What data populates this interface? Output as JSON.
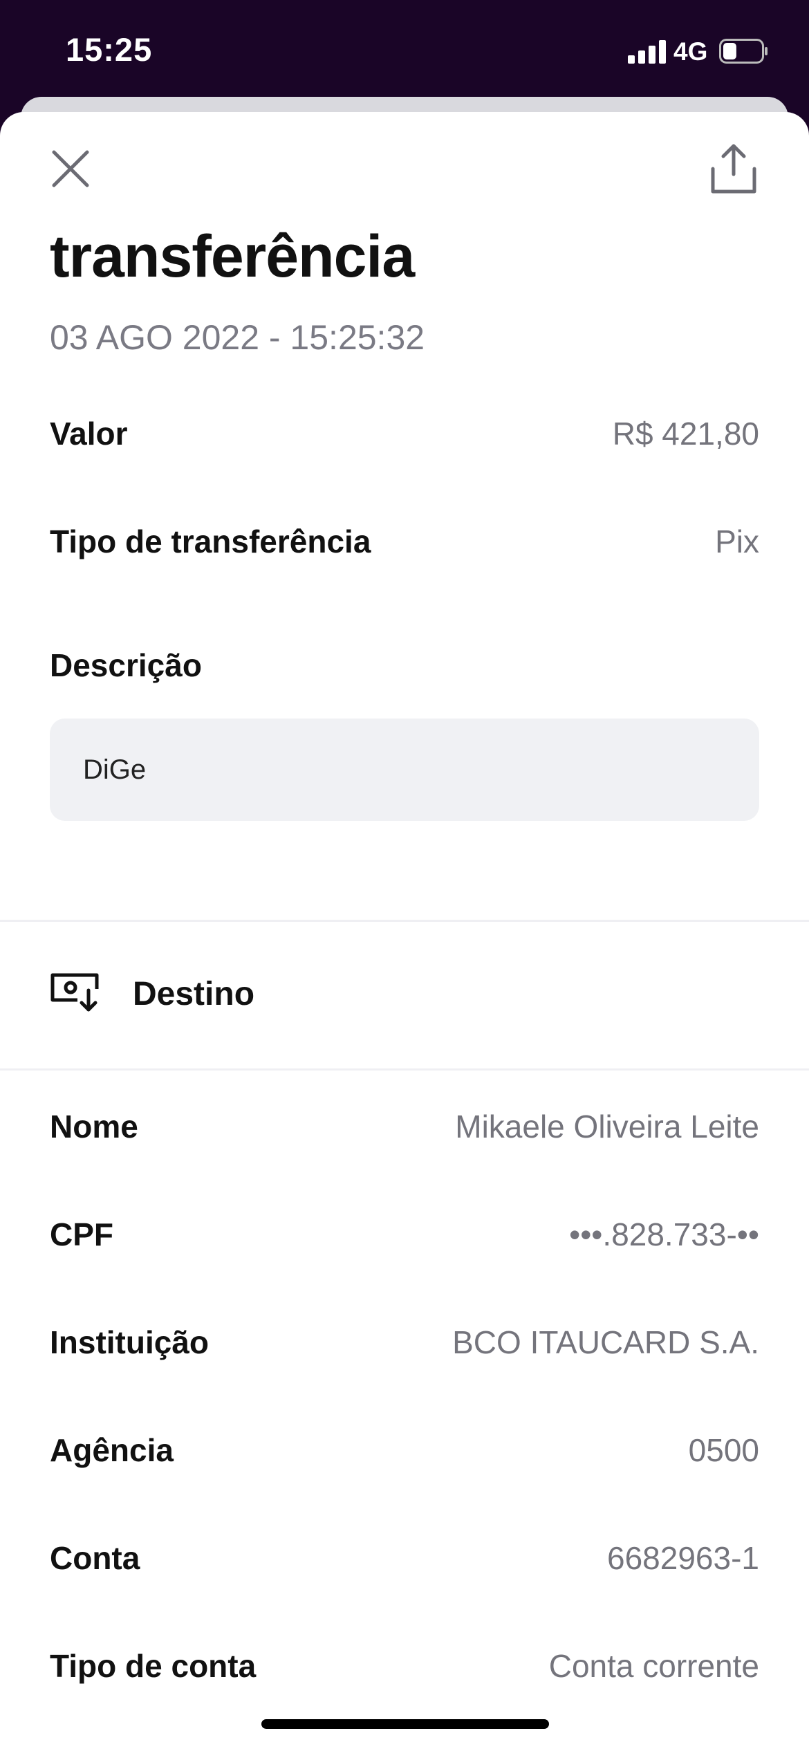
{
  "status_bar": {
    "time": "15:25",
    "network": "4G",
    "battery_level": 0.35
  },
  "header": {
    "close_icon": "close-icon",
    "share_icon": "share-icon"
  },
  "transfer": {
    "title": "transferência",
    "timestamp": "03 AGO 2022 - 15:25:32",
    "rows": [
      {
        "label": "Valor",
        "value": "R$ 421,80"
      },
      {
        "label": "Tipo de transferência",
        "value": "Pix"
      }
    ],
    "description_label": "Descrição",
    "description": "DiGe"
  },
  "destination": {
    "section_title": "Destino",
    "icon": "destination-icon",
    "rows": [
      {
        "label": "Nome",
        "value": "Mikaele Oliveira Leite"
      },
      {
        "label": "CPF",
        "value": "•••.828.733-••"
      },
      {
        "label": "Instituição",
        "value": "BCO ITAUCARD S.A."
      },
      {
        "label": "Agência",
        "value": "0500"
      },
      {
        "label": "Conta",
        "value": "6682963-1"
      },
      {
        "label": "Tipo de conta",
        "value": "Conta corrente"
      }
    ]
  },
  "colors": {
    "status_bar_bg": "#1a0527",
    "text_primary": "#111111",
    "text_secondary": "#74747c",
    "description_bg": "#f0f1f4"
  }
}
